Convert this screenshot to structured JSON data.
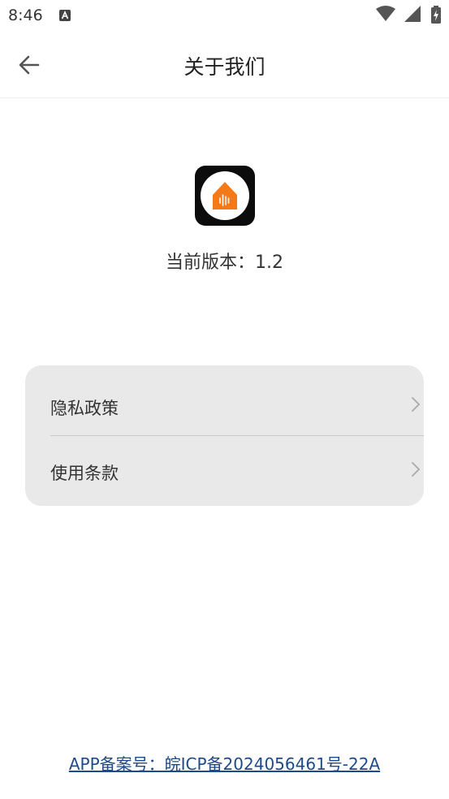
{
  "status_bar": {
    "time": "8:46",
    "notification_icon": "a-notification-icon",
    "wifi_icon": "wifi-icon",
    "signal_icon": "cell-signal-icon",
    "battery_icon": "battery-charging-icon"
  },
  "app_bar": {
    "back_icon": "arrow-left-icon",
    "title": "关于我们"
  },
  "about": {
    "logo_icon": "app-logo-icon",
    "logo_accent_color": "#f57a17",
    "version_text": "当前版本：1.2"
  },
  "menu": {
    "items": [
      {
        "label": "隐私政策",
        "icon": "chevron-right-icon"
      },
      {
        "label": "使用条款",
        "icon": "chevron-right-icon"
      }
    ]
  },
  "footer": {
    "icp_text": "APP备案号：皖ICP备2024056461号-22A",
    "link_color": "#1f4a8a"
  }
}
